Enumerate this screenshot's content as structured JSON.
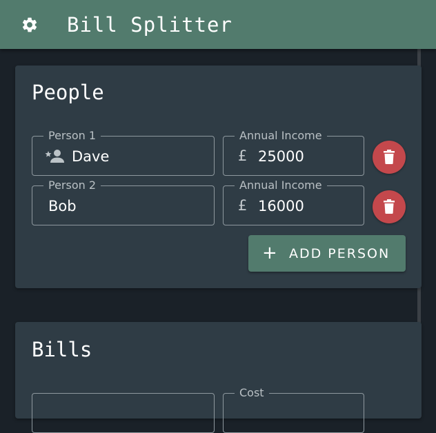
{
  "app_bar": {
    "title": "Bill Splitter",
    "settings_icon": "gear-icon",
    "color": "#527b6d"
  },
  "people": {
    "title": "People",
    "persons": [
      {
        "label": "Person 1",
        "name": "Dave",
        "icon": "person-star-icon",
        "income_label": "Annual Income",
        "currency": "£",
        "income": "25000"
      },
      {
        "label": "Person 2",
        "name": "Bob",
        "income_label": "Annual Income",
        "currency": "£",
        "income": "16000"
      }
    ],
    "add_button_icon": "+",
    "add_button_label": "ADD PERSON",
    "delete_icon": "trash-icon",
    "delete_color": "#c4484c"
  },
  "bills": {
    "title": "Bills",
    "cost_label": "Cost"
  }
}
